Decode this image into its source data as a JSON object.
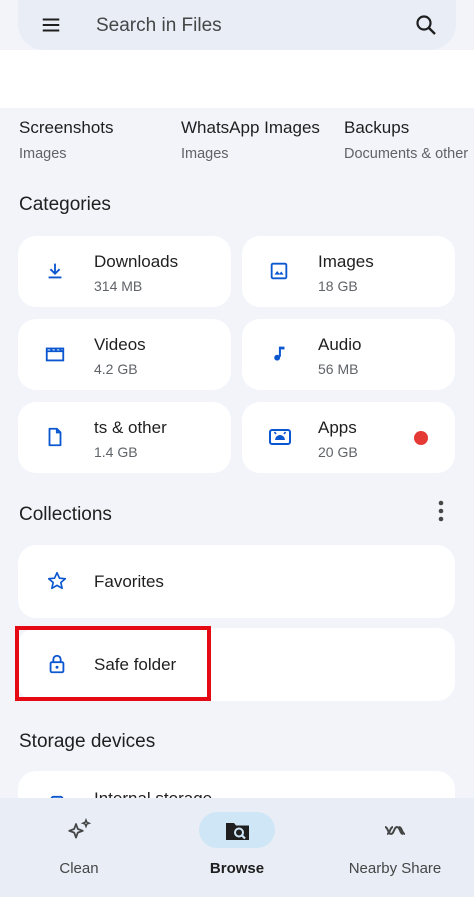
{
  "search": {
    "placeholder": "Search in Files",
    "menu_icon": "menu-icon",
    "search_icon": "search-icon"
  },
  "recent": [
    {
      "name": "Screenshots",
      "sub": "Images"
    },
    {
      "name": "WhatsApp Images",
      "sub": "Images"
    },
    {
      "name": "Backups",
      "sub": "Documents & other"
    }
  ],
  "categories": {
    "title": "Categories",
    "items": [
      {
        "name": "Downloads",
        "size": "314 MB",
        "icon": "download-icon"
      },
      {
        "name": "Images",
        "size": "18 GB",
        "icon": "image-icon"
      },
      {
        "name": "Videos",
        "size": "4.2 GB",
        "icon": "video-icon"
      },
      {
        "name": "Audio",
        "size": "56 MB",
        "icon": "music-note-icon"
      },
      {
        "name": "ts & other",
        "size": "1.4 GB",
        "icon": "document-icon"
      },
      {
        "name": "Apps",
        "size": "20 GB",
        "icon": "android-icon",
        "badge_color": "#e53935"
      }
    ]
  },
  "collections": {
    "title": "Collections",
    "items": [
      {
        "label": "Favorites",
        "icon": "star-icon"
      },
      {
        "label": "Safe folder",
        "icon": "lock-icon"
      }
    ]
  },
  "storage": {
    "title": "Storage devices",
    "items": [
      {
        "label": "Internal storage",
        "icon": "phone-icon"
      }
    ]
  },
  "bottom_nav": [
    {
      "label": "Clean",
      "icon": "sparkle-icon",
      "active": false
    },
    {
      "label": "Browse",
      "icon": "browse-folder-icon",
      "active": true
    },
    {
      "label": "Nearby Share",
      "icon": "nearby-share-icon",
      "active": false
    }
  ],
  "colors": {
    "accent": "#0b57d0",
    "icon_blue": "#0b57d0",
    "highlight": "#e50914",
    "nav_active": "#cfe6f6",
    "page_bg": "#f2f4fa"
  }
}
